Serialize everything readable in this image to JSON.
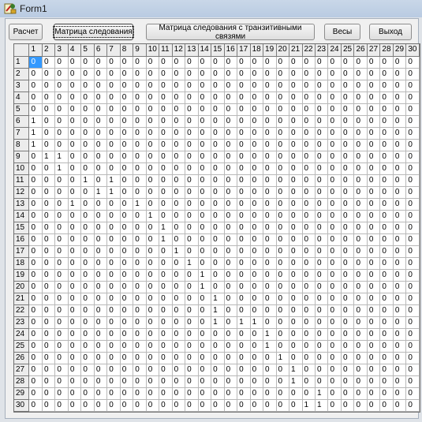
{
  "window": {
    "title": "Form1"
  },
  "toolbar": {
    "buttons": [
      {
        "label": "Расчет"
      },
      {
        "label": "Матрица следования"
      },
      {
        "label": "Матрица следования с транзитивными связями"
      },
      {
        "label": "Весы"
      },
      {
        "label": "Выход"
      }
    ]
  },
  "grid": {
    "columns": [
      "1",
      "2",
      "3",
      "4",
      "5",
      "6",
      "7",
      "8",
      "9",
      "10",
      "11",
      "12",
      "13",
      "14",
      "15",
      "16",
      "17",
      "18",
      "19",
      "20",
      "21",
      "22",
      "23",
      "24",
      "25",
      "26",
      "27",
      "28",
      "29",
      "30"
    ],
    "rows": [
      {
        "label": "1",
        "cells": [
          0,
          0,
          0,
          0,
          0,
          0,
          0,
          0,
          0,
          0,
          0,
          0,
          0,
          0,
          0,
          0,
          0,
          0,
          0,
          0,
          0,
          0,
          0,
          0,
          0,
          0,
          0,
          0,
          0,
          0
        ]
      },
      {
        "label": "2",
        "cells": [
          0,
          0,
          0,
          0,
          0,
          0,
          0,
          0,
          0,
          0,
          0,
          0,
          0,
          0,
          0,
          0,
          0,
          0,
          0,
          0,
          0,
          0,
          0,
          0,
          0,
          0,
          0,
          0,
          0,
          0
        ]
      },
      {
        "label": "3",
        "cells": [
          0,
          0,
          0,
          0,
          0,
          0,
          0,
          0,
          0,
          0,
          0,
          0,
          0,
          0,
          0,
          0,
          0,
          0,
          0,
          0,
          0,
          0,
          0,
          0,
          0,
          0,
          0,
          0,
          0,
          0
        ]
      },
      {
        "label": "4",
        "cells": [
          0,
          0,
          0,
          0,
          0,
          0,
          0,
          0,
          0,
          0,
          0,
          0,
          0,
          0,
          0,
          0,
          0,
          0,
          0,
          0,
          0,
          0,
          0,
          0,
          0,
          0,
          0,
          0,
          0,
          0
        ]
      },
      {
        "label": "5",
        "cells": [
          0,
          0,
          0,
          0,
          0,
          0,
          0,
          0,
          0,
          0,
          0,
          0,
          0,
          0,
          0,
          0,
          0,
          0,
          0,
          0,
          0,
          0,
          0,
          0,
          0,
          0,
          0,
          0,
          0,
          0
        ]
      },
      {
        "label": "6",
        "cells": [
          1,
          0,
          0,
          0,
          0,
          0,
          0,
          0,
          0,
          0,
          0,
          0,
          0,
          0,
          0,
          0,
          0,
          0,
          0,
          0,
          0,
          0,
          0,
          0,
          0,
          0,
          0,
          0,
          0,
          0
        ]
      },
      {
        "label": "7",
        "cells": [
          1,
          0,
          0,
          0,
          0,
          0,
          0,
          0,
          0,
          0,
          0,
          0,
          0,
          0,
          0,
          0,
          0,
          0,
          0,
          0,
          0,
          0,
          0,
          0,
          0,
          0,
          0,
          0,
          0,
          0
        ]
      },
      {
        "label": "8",
        "cells": [
          1,
          0,
          0,
          0,
          0,
          0,
          0,
          0,
          0,
          0,
          0,
          0,
          0,
          0,
          0,
          0,
          0,
          0,
          0,
          0,
          0,
          0,
          0,
          0,
          0,
          0,
          0,
          0,
          0,
          0
        ]
      },
      {
        "label": "9",
        "cells": [
          0,
          1,
          1,
          0,
          0,
          0,
          0,
          0,
          0,
          0,
          0,
          0,
          0,
          0,
          0,
          0,
          0,
          0,
          0,
          0,
          0,
          0,
          0,
          0,
          0,
          0,
          0,
          0,
          0,
          0
        ]
      },
      {
        "label": "10",
        "cells": [
          0,
          0,
          1,
          0,
          0,
          0,
          0,
          0,
          0,
          0,
          0,
          0,
          0,
          0,
          0,
          0,
          0,
          0,
          0,
          0,
          0,
          0,
          0,
          0,
          0,
          0,
          0,
          0,
          0,
          0
        ]
      },
      {
        "label": "11",
        "cells": [
          0,
          0,
          0,
          0,
          1,
          0,
          1,
          0,
          0,
          0,
          0,
          0,
          0,
          0,
          0,
          0,
          0,
          0,
          0,
          0,
          0,
          0,
          0,
          0,
          0,
          0,
          0,
          0,
          0,
          0
        ]
      },
      {
        "label": "12",
        "cells": [
          0,
          0,
          0,
          0,
          0,
          1,
          1,
          0,
          0,
          0,
          0,
          0,
          0,
          0,
          0,
          0,
          0,
          0,
          0,
          0,
          0,
          0,
          0,
          0,
          0,
          0,
          0,
          0,
          0,
          0
        ]
      },
      {
        "label": "13",
        "cells": [
          0,
          0,
          0,
          1,
          0,
          0,
          0,
          0,
          1,
          0,
          0,
          0,
          0,
          0,
          0,
          0,
          0,
          0,
          0,
          0,
          0,
          0,
          0,
          0,
          0,
          0,
          0,
          0,
          0,
          0
        ]
      },
      {
        "label": "14",
        "cells": [
          0,
          0,
          0,
          0,
          0,
          0,
          0,
          0,
          0,
          1,
          0,
          0,
          0,
          0,
          0,
          0,
          0,
          0,
          0,
          0,
          0,
          0,
          0,
          0,
          0,
          0,
          0,
          0,
          0,
          0
        ]
      },
      {
        "label": "15",
        "cells": [
          0,
          0,
          0,
          0,
          0,
          0,
          0,
          0,
          0,
          0,
          1,
          0,
          0,
          0,
          0,
          0,
          0,
          0,
          0,
          0,
          0,
          0,
          0,
          0,
          0,
          0,
          0,
          0,
          0,
          0
        ]
      },
      {
        "label": "16",
        "cells": [
          0,
          0,
          0,
          0,
          0,
          0,
          0,
          0,
          0,
          0,
          1,
          0,
          0,
          0,
          0,
          0,
          0,
          0,
          0,
          0,
          0,
          0,
          0,
          0,
          0,
          0,
          0,
          0,
          0,
          0
        ]
      },
      {
        "label": "17",
        "cells": [
          0,
          0,
          0,
          0,
          0,
          0,
          0,
          0,
          0,
          0,
          0,
          1,
          0,
          0,
          0,
          0,
          0,
          0,
          0,
          0,
          0,
          0,
          0,
          0,
          0,
          0,
          0,
          0,
          0,
          0
        ]
      },
      {
        "label": "18",
        "cells": [
          0,
          0,
          0,
          0,
          0,
          0,
          0,
          0,
          0,
          0,
          0,
          0,
          1,
          0,
          0,
          0,
          0,
          0,
          0,
          0,
          0,
          0,
          0,
          0,
          0,
          0,
          0,
          0,
          0,
          0
        ]
      },
      {
        "label": "19",
        "cells": [
          0,
          0,
          0,
          0,
          0,
          0,
          0,
          0,
          0,
          0,
          0,
          0,
          0,
          1,
          0,
          0,
          0,
          0,
          0,
          0,
          0,
          0,
          0,
          0,
          0,
          0,
          0,
          0,
          0,
          0
        ]
      },
      {
        "label": "20",
        "cells": [
          0,
          0,
          0,
          0,
          0,
          0,
          0,
          0,
          0,
          0,
          0,
          0,
          0,
          1,
          0,
          0,
          0,
          0,
          0,
          0,
          0,
          0,
          0,
          0,
          0,
          0,
          0,
          0,
          0,
          0
        ]
      },
      {
        "label": "21",
        "cells": [
          0,
          0,
          0,
          0,
          0,
          0,
          0,
          0,
          0,
          0,
          0,
          0,
          0,
          0,
          1,
          0,
          0,
          0,
          0,
          0,
          0,
          0,
          0,
          0,
          0,
          0,
          0,
          0,
          0,
          0
        ]
      },
      {
        "label": "22",
        "cells": [
          0,
          0,
          0,
          0,
          0,
          0,
          0,
          0,
          0,
          0,
          0,
          0,
          0,
          0,
          1,
          0,
          0,
          0,
          0,
          0,
          0,
          0,
          0,
          0,
          0,
          0,
          0,
          0,
          0,
          0
        ]
      },
      {
        "label": "23",
        "cells": [
          0,
          0,
          0,
          0,
          0,
          0,
          0,
          0,
          0,
          0,
          0,
          0,
          0,
          0,
          1,
          0,
          1,
          1,
          0,
          0,
          0,
          0,
          0,
          0,
          0,
          0,
          0,
          0,
          0,
          0
        ]
      },
      {
        "label": "24",
        "cells": [
          0,
          0,
          0,
          0,
          0,
          0,
          0,
          0,
          0,
          0,
          0,
          0,
          0,
          0,
          0,
          0,
          0,
          0,
          1,
          0,
          0,
          0,
          0,
          0,
          0,
          0,
          0,
          0,
          0,
          0
        ]
      },
      {
        "label": "25",
        "cells": [
          0,
          0,
          0,
          0,
          0,
          0,
          0,
          0,
          0,
          0,
          0,
          0,
          0,
          0,
          0,
          0,
          0,
          0,
          1,
          0,
          0,
          0,
          0,
          0,
          0,
          0,
          0,
          0,
          0,
          0
        ]
      },
      {
        "label": "26",
        "cells": [
          0,
          0,
          0,
          0,
          0,
          0,
          0,
          0,
          0,
          0,
          0,
          0,
          0,
          0,
          0,
          0,
          0,
          0,
          0,
          1,
          0,
          0,
          0,
          0,
          0,
          0,
          0,
          0,
          0,
          0
        ]
      },
      {
        "label": "27",
        "cells": [
          0,
          0,
          0,
          0,
          0,
          0,
          0,
          0,
          0,
          0,
          0,
          0,
          0,
          0,
          0,
          0,
          0,
          0,
          0,
          0,
          1,
          0,
          0,
          0,
          0,
          0,
          0,
          0,
          0,
          0
        ]
      },
      {
        "label": "28",
        "cells": [
          0,
          0,
          0,
          0,
          0,
          0,
          0,
          0,
          0,
          0,
          0,
          0,
          0,
          0,
          0,
          0,
          0,
          0,
          0,
          0,
          1,
          0,
          0,
          0,
          0,
          0,
          0,
          0,
          0,
          0
        ]
      },
      {
        "label": "29",
        "cells": [
          0,
          0,
          0,
          0,
          0,
          0,
          0,
          0,
          0,
          0,
          0,
          0,
          0,
          0,
          0,
          0,
          0,
          0,
          0,
          0,
          0,
          0,
          1,
          0,
          0,
          0,
          0,
          0,
          0,
          0
        ]
      },
      {
        "label": "30",
        "cells": [
          0,
          0,
          0,
          0,
          0,
          0,
          0,
          0,
          0,
          0,
          0,
          0,
          0,
          0,
          0,
          0,
          0,
          0,
          0,
          0,
          0,
          1,
          1,
          0,
          0,
          0,
          0,
          0,
          0,
          0
        ]
      }
    ],
    "selected_row": 1,
    "selected_col": 1
  },
  "colors": {
    "selection": "#3399ff",
    "fixed_cell": "#ececec"
  },
  "icons": {
    "app": "delphi-app-icon"
  }
}
